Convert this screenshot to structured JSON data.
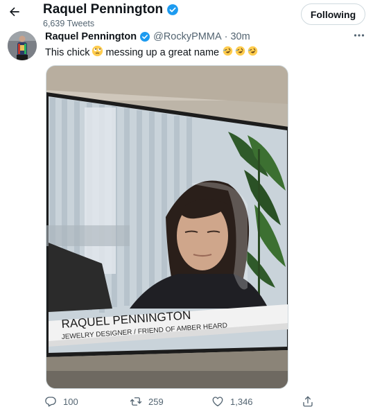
{
  "header": {
    "name": "Raquel Pennington",
    "tweet_count": "6,639 Tweets",
    "follow_label": "Following"
  },
  "tweet": {
    "name": "Raquel Pennington",
    "handle": "@RockyPMMA",
    "separator": "·",
    "time": "30m",
    "text_before": "This chick",
    "text_after": "messing up a great name",
    "media": {
      "caption_name": "RAQUEL PENNINGTON",
      "caption_subtitle": "JEWELRY DESIGNER / FRIEND OF AMBER HEARD"
    }
  },
  "actions": {
    "replies": "100",
    "retweets": "259",
    "likes": "1,346"
  },
  "colors": {
    "verified": "#1d9bf0",
    "text_primary": "#0f1419",
    "text_secondary": "#536471",
    "border": "#cfd9de"
  },
  "icons": [
    "back-arrow-icon",
    "verified-badge-icon",
    "more-icon",
    "rolling-eyes-emoji",
    "rofl-emoji",
    "reply-icon",
    "retweet-icon",
    "like-icon",
    "share-icon"
  ]
}
